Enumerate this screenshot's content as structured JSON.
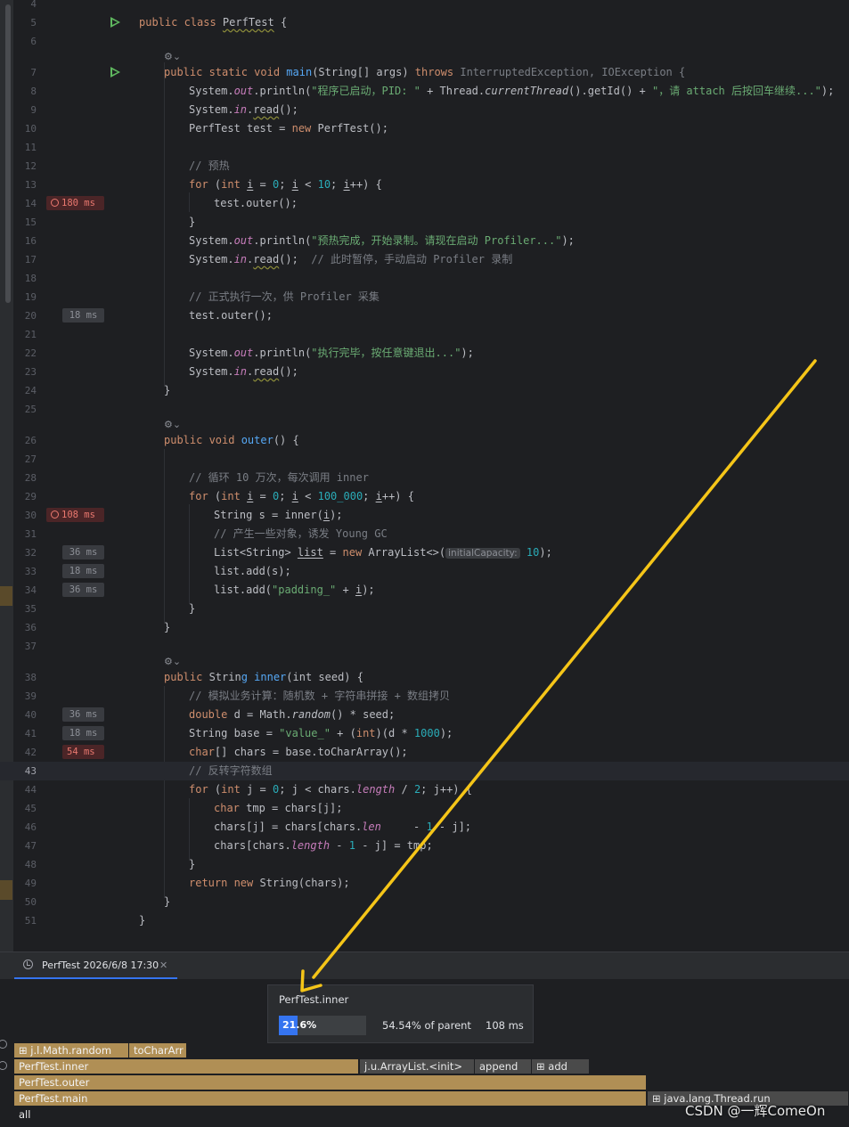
{
  "editor": {
    "line_numbers": [
      "4",
      "5",
      "6",
      "7",
      "8",
      "9",
      "10",
      "11",
      "12",
      "13",
      "14",
      "15",
      "16",
      "17",
      "18",
      "19",
      "20",
      "21",
      "22",
      "23",
      "24",
      "25",
      "26",
      "27",
      "28",
      "29",
      "30",
      "31",
      "32",
      "33",
      "34",
      "35",
      "36",
      "37",
      "38",
      "39",
      "40",
      "41",
      "42",
      "43",
      "44",
      "45",
      "46",
      "47",
      "48",
      "49",
      "50",
      "51"
    ],
    "class_decl": {
      "kw": "public class ",
      "name": "PerfTest",
      "rest": " {"
    },
    "main_decl": {
      "kw": "public static void ",
      "name": "main",
      "params": "(String[] args) ",
      "throws": "throws ",
      "exceptions": "InterruptedException, IOException {"
    },
    "l8": {
      "a": "System.",
      "out": "out",
      "b": ".println(",
      "s1": "\"程序已启动，PID: \"",
      "c": " + Thread.",
      "ct": "currentThread",
      "d": "().getId() + ",
      "s2": "\"，请 attach 后按回车继续...\"",
      "e": ");"
    },
    "l9": {
      "a": "System.",
      "in": "in",
      "b": ".",
      "read": "read",
      "c": "();"
    },
    "l10": {
      "a": "PerfTest test = ",
      "new": "new",
      "b": " PerfTest();"
    },
    "l12": "// 预热",
    "l13": {
      "for": "for",
      "a": " (",
      "int": "int",
      "i1": "i",
      "b": " = ",
      "n0": "0",
      "c": "; ",
      "i2": "i",
      "d": " < ",
      "n10": "10",
      "e": "; ",
      "i3": "i",
      "f": "++) {"
    },
    "l14": "test.outer();",
    "l15": "}",
    "l16": {
      "a": "System.",
      "out": "out",
      "b": ".println(",
      "s": "\"预热完成，开始录制。请现在启动 Profiler...\"",
      "c": ");"
    },
    "l17": {
      "a": "System.",
      "in": "in",
      "b": ".",
      "read": "read",
      "c": "();  ",
      "cm": "// 此时暂停，手动启动 Profiler 录制"
    },
    "l19": "// 正式执行一次，供 Profiler 采集",
    "l20": "test.outer();",
    "l22": {
      "a": "System.",
      "out": "out",
      "b": ".println(",
      "s": "\"执行完毕，按任意键退出...\"",
      "c": ");"
    },
    "l23": {
      "a": "System.",
      "in": "in",
      "b": ".",
      "read": "read",
      "c": "();"
    },
    "l24": "}",
    "l26": {
      "kw": "public void ",
      "name": "outer",
      "rest": "() {"
    },
    "l28": "// 循环 10 万次，每次调用 inner",
    "l29": {
      "for": "for",
      "a": " (",
      "int": "int",
      "i1": "i",
      "b": " = ",
      "n0": "0",
      "c": "; ",
      "i2": "i",
      "d": " < ",
      "n": "100_000",
      "e": "; ",
      "i3": "i",
      "f": "++) {"
    },
    "l30": {
      "a": "String s = inner(",
      "i": "i",
      "b": ");"
    },
    "l31": "// 产生一些对象，诱发 Young GC",
    "l32": {
      "a": "List<String> ",
      "v": "list",
      "b": " = ",
      "new": "new",
      "c": " ArrayList<>(",
      "hint": "initialCapacity:",
      "n": "10",
      "d": ");"
    },
    "l33": "list.add(s);",
    "l34": {
      "a": "list.add(",
      "s": "\"padding_\"",
      "b": " + ",
      "i": "i",
      "c": ");"
    },
    "l35": "}",
    "l36": "}",
    "l38": {
      "kw": "public ",
      "a": "Strin",
      "name": "g inner",
      "rest": "(int seed) {"
    },
    "l39": "// 模拟业务计算：随机数 + 字符串拼接 + 数组拷贝",
    "l40": {
      "kw": "double",
      "a": " d = Math.",
      "r": "random",
      "b": "() * seed;"
    },
    "l41": {
      "a": "String base = ",
      "s": "\"value_\"",
      "b": " + (",
      "int": "int",
      "c": ")(d * ",
      "n": "1000",
      "d": ");"
    },
    "l42": {
      "kw": "char",
      "a": "[] chars = base.toCharArray();"
    },
    "l43": "// 反转字符数组",
    "l44": {
      "for": "for",
      "a": " (",
      "int": "int",
      "b": " j = ",
      "n0": "0",
      "c": "; j < chars.",
      "len": "length",
      "d": " / ",
      "n2": "2",
      "e": "; j++) {"
    },
    "l45": {
      "kw": "char",
      "a": " tmp = chars[j];"
    },
    "l46": {
      "a": "chars[j] = chars[chars.",
      "len": "len",
      "b": "     - ",
      "n": "1",
      "c": " - j];"
    },
    "l47": {
      "a": "chars[chars.",
      "len": "length",
      "b": " - ",
      "n": "1",
      "c": " - j] = tmp;"
    },
    "l48": "}",
    "l49": {
      "kw": "return new ",
      "a": "String(chars);"
    },
    "l50": "}",
    "l51": "}",
    "gutter_times": {
      "l14": "180 ms",
      "l20": "18 ms",
      "l30": "108 ms",
      "l32": "36 ms",
      "l33": "18 ms",
      "l34": "36 ms",
      "l40": "36 ms",
      "l41": "18 ms",
      "l42": "54 ms"
    }
  },
  "profiler_tab": {
    "label": "PerfTest 2026/6/8 17:30",
    "close": "✕"
  },
  "tooltip": {
    "title": "PerfTest.inner",
    "percent": 21.6,
    "percent_label": "21.6%",
    "parent_label": "54.54% of parent",
    "time": "108 ms"
  },
  "flame": {
    "row1": {
      "a": "j.l.Math.random",
      "b": "toCharArr"
    },
    "row2": {
      "a": "PerfTest.inner",
      "b": "j.u.ArrayList.<init>",
      "c": "append",
      "d": "add"
    },
    "row3": {
      "a": "PerfTest.outer"
    },
    "row4": {
      "a": "PerfTest.main",
      "b": "java.lang.Thread.run"
    },
    "row5": {
      "a": "all"
    }
  },
  "watermark": "CSDN @一辉ComeOn",
  "colors": {
    "accent": "#3574f0",
    "flame_frame": "#b08f55",
    "arrow": "#f5c518",
    "hot_badge": "#e9786f"
  }
}
